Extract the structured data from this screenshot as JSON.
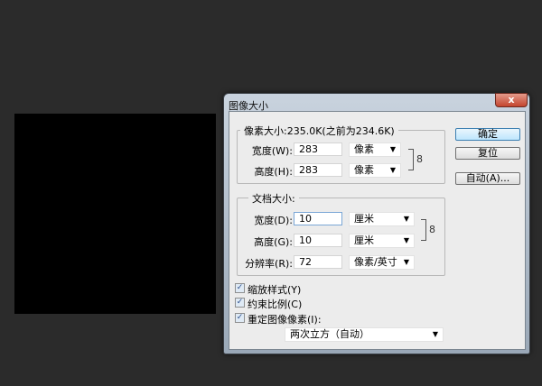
{
  "dialog": {
    "title": "图像大小",
    "close": "x",
    "pixel_dimensions": {
      "legend": "像素大小:235.0K(之前为234.6K)",
      "width_label": "宽度(W):",
      "width_value": "283",
      "width_unit": "像素",
      "height_label": "高度(H):",
      "height_value": "283",
      "height_unit": "像素"
    },
    "document_size": {
      "legend": "文档大小:",
      "width_label": "宽度(D):",
      "width_value": "10",
      "width_unit": "厘米",
      "height_label": "高度(G):",
      "height_value": "10",
      "height_unit": "厘米",
      "resolution_label": "分辨率(R):",
      "resolution_value": "72",
      "resolution_unit": "像素/英寸"
    },
    "options": {
      "scale_styles": "缩放样式(Y)",
      "constrain_proportions": "约束比例(C)",
      "resample": "重定图像像素(I):",
      "resample_method": "两次立方（自动）",
      "check": "✓"
    },
    "buttons": {
      "ok": "确定",
      "reset": "复位",
      "auto": "自动(A)..."
    },
    "arrow": "▼",
    "link": "8"
  }
}
